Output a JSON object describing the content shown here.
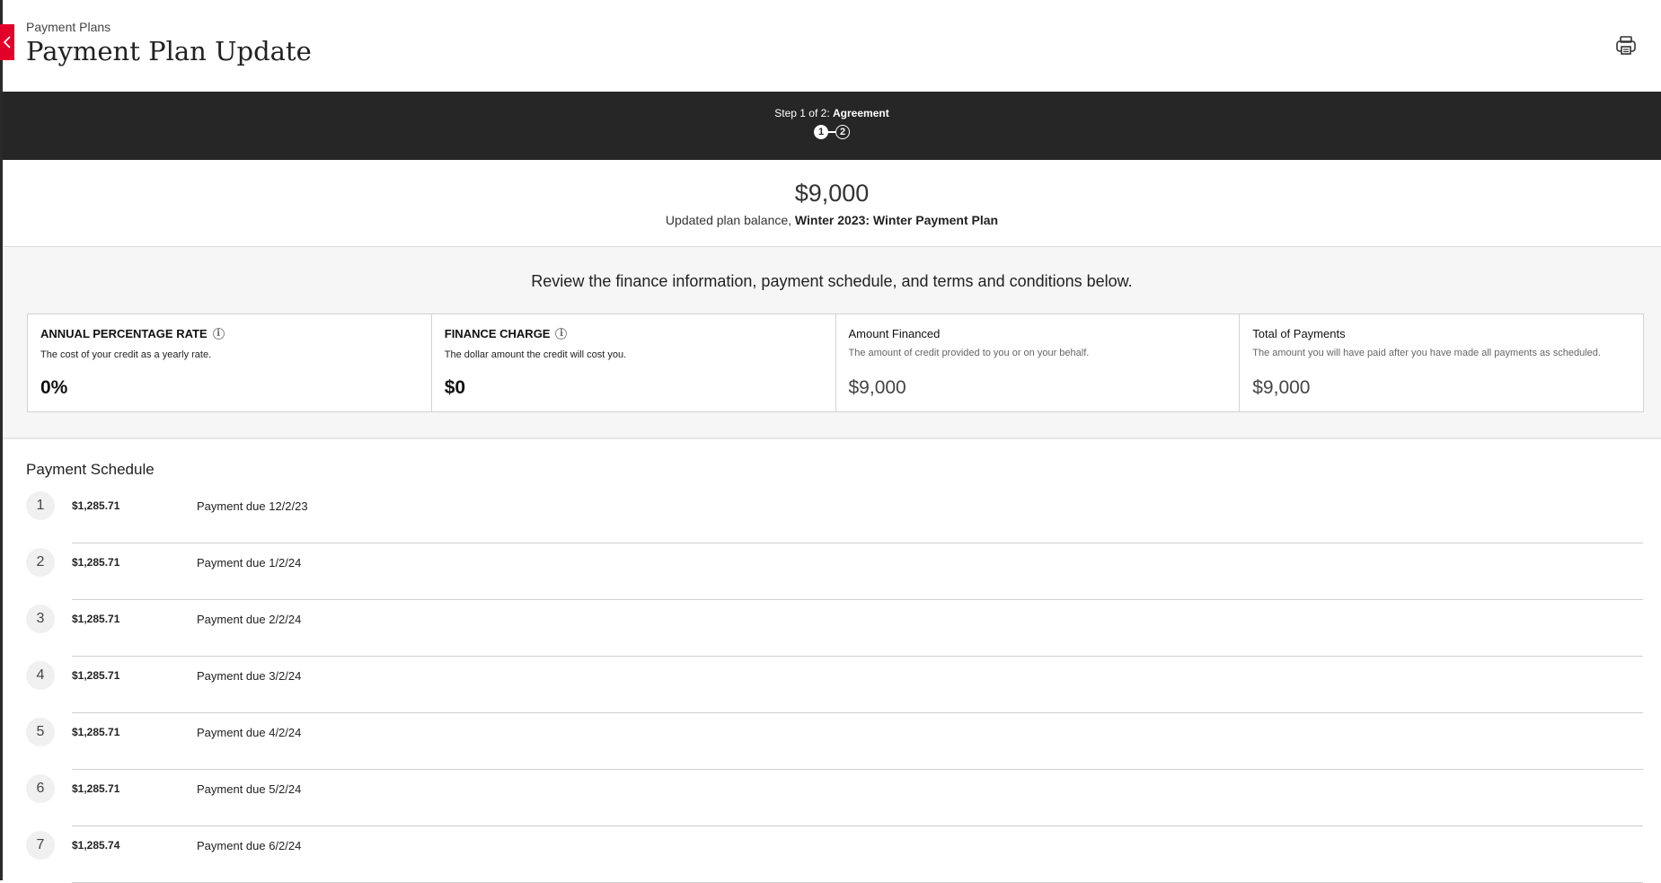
{
  "breadcrumb": "Payment Plans",
  "title": "Payment Plan Update",
  "close_icon": "close-icon",
  "print_icon": "printer-icon",
  "stepper": {
    "step_prefix": "Step 1 of 2:",
    "step_name": "Agreement",
    "steps": [
      "1",
      "2"
    ],
    "active_step": 1
  },
  "balance": {
    "amount": "$9,000",
    "label": "Updated plan balance,",
    "plan_name": "Winter 2023: Winter Payment Plan"
  },
  "finance": {
    "review_text": "Review the finance information, payment schedule, and terms and conditions below.",
    "boxes": [
      {
        "heading": "ANNUAL PERCENTAGE RATE",
        "description": "The cost of your credit as a yearly rate.",
        "value": "0%"
      },
      {
        "heading": "FINANCE CHARGE",
        "description": "The dollar amount the credit will cost you.",
        "value": "$0"
      },
      {
        "heading": "Amount Financed",
        "description": "The amount of credit provided to you or on your behalf.",
        "value": "$9,000"
      },
      {
        "heading": "Total of Payments",
        "description": "The amount you will have paid after you have made all payments as scheduled.",
        "value": "$9,000"
      }
    ]
  },
  "schedule": {
    "title": "Payment Schedule",
    "rows": [
      {
        "num": "1",
        "amount": "$1,285.71",
        "due": "Payment due 12/2/23"
      },
      {
        "num": "2",
        "amount": "$1,285.71",
        "due": "Payment due 1/2/24"
      },
      {
        "num": "3",
        "amount": "$1,285.71",
        "due": "Payment due 2/2/24"
      },
      {
        "num": "4",
        "amount": "$1,285.71",
        "due": "Payment due 3/2/24"
      },
      {
        "num": "5",
        "amount": "$1,285.71",
        "due": "Payment due 4/2/24"
      },
      {
        "num": "6",
        "amount": "$1,285.71",
        "due": "Payment due 5/2/24"
      },
      {
        "num": "7",
        "amount": "$1,285.74",
        "due": "Payment due 6/2/24"
      }
    ]
  },
  "colors": {
    "accent_red": "#e2002b",
    "stepper_bg": "#262626",
    "section_bg": "#f6f6f6"
  }
}
